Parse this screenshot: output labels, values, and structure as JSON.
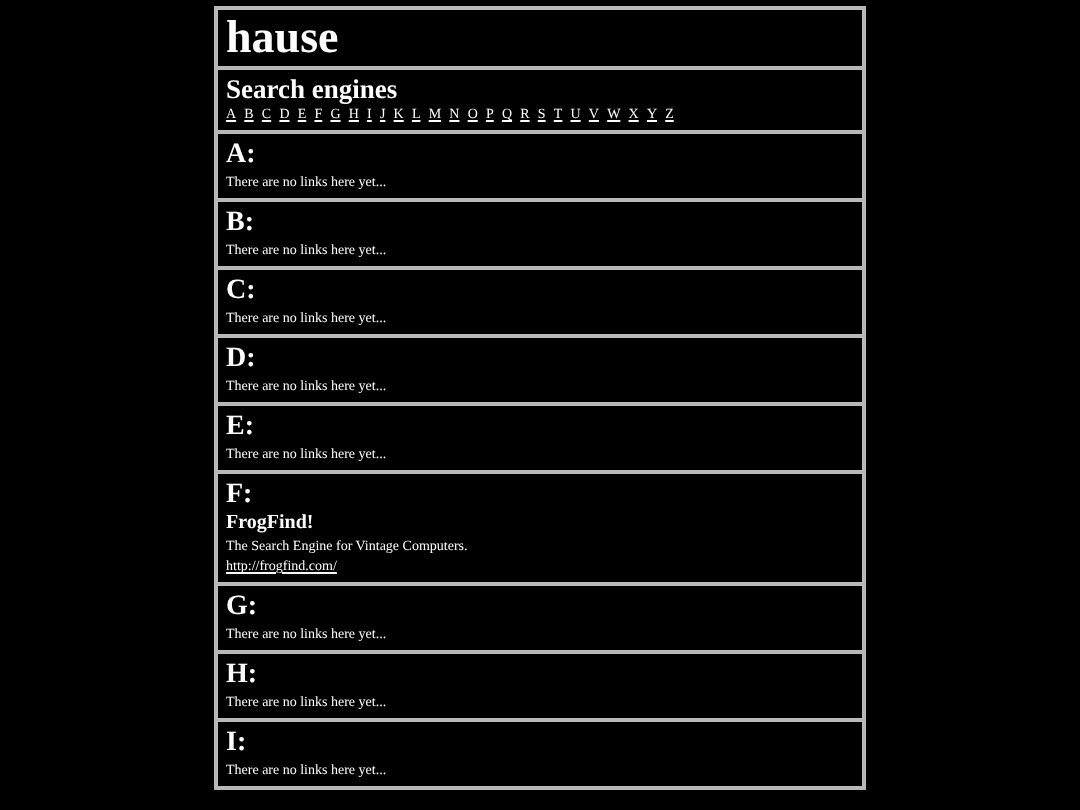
{
  "site": {
    "title": "hause"
  },
  "category": {
    "title": "Search engines",
    "letters": [
      "A",
      "B",
      "C",
      "D",
      "E",
      "F",
      "G",
      "H",
      "I",
      "J",
      "K",
      "L",
      "M",
      "N",
      "O",
      "P",
      "Q",
      "R",
      "S",
      "T",
      "U",
      "V",
      "W",
      "X",
      "Y",
      "Z"
    ]
  },
  "sections": [
    {
      "heading": "A:",
      "empty_text": "There are no links here yet..."
    },
    {
      "heading": "B:",
      "empty_text": "There are no links here yet..."
    },
    {
      "heading": "C:",
      "empty_text": "There are no links here yet..."
    },
    {
      "heading": "D:",
      "empty_text": "There are no links here yet..."
    },
    {
      "heading": "E:",
      "empty_text": "There are no links here yet..."
    },
    {
      "heading": "F:",
      "links": [
        {
          "name": "FrogFind!",
          "description": "The Search Engine for Vintage Computers.",
          "url": "http://frogfind.com/"
        }
      ]
    },
    {
      "heading": "G:",
      "empty_text": "There are no links here yet..."
    },
    {
      "heading": "H:",
      "empty_text": "There are no links here yet..."
    },
    {
      "heading": "I:",
      "empty_text": "There are no links here yet..."
    }
  ]
}
